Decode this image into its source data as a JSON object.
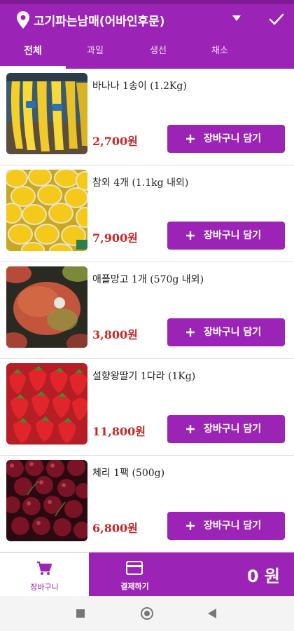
{
  "header": {
    "store_name": "고기파는남매(어바인후문)",
    "tabs": [
      {
        "label": "전체",
        "active": true
      },
      {
        "label": "과일",
        "active": false
      },
      {
        "label": "생선",
        "active": false
      },
      {
        "label": "채소",
        "active": false
      }
    ]
  },
  "products": [
    {
      "name": "바나나 1송이 (1.2Kg)",
      "price": "2,700원",
      "button_label": "장바구니 담기",
      "image": "bananas"
    },
    {
      "name": "참외 4개 (1.1kg 내외)",
      "price": "7,900원",
      "button_label": "장바구니 담기",
      "image": "korean-melons"
    },
    {
      "name": "애플망고 1개 (570g 내외)",
      "price": "3,800원",
      "button_label": "장바구니 담기",
      "image": "apple-mango"
    },
    {
      "name": "설향왕딸기 1다라 (1Kg)",
      "price": "11,800원",
      "button_label": "장바구니 담기",
      "image": "strawberries"
    },
    {
      "name": "체리 1팩 (500g)",
      "price": "6,800원",
      "button_label": "장바구니 담기",
      "image": "cherries"
    }
  ],
  "bottom_nav": {
    "cart_label": "장바구니",
    "pay_label": "결제하기",
    "total": "0 원"
  },
  "colors": {
    "accent": "#9b24b6",
    "price": "#c62828"
  },
  "icons": [
    "location-pin-icon",
    "dropdown-caret-icon",
    "check-icon",
    "plus-icon",
    "shopping-cart-icon",
    "credit-card-icon",
    "recent-apps-icon",
    "home-icon",
    "back-icon"
  ]
}
